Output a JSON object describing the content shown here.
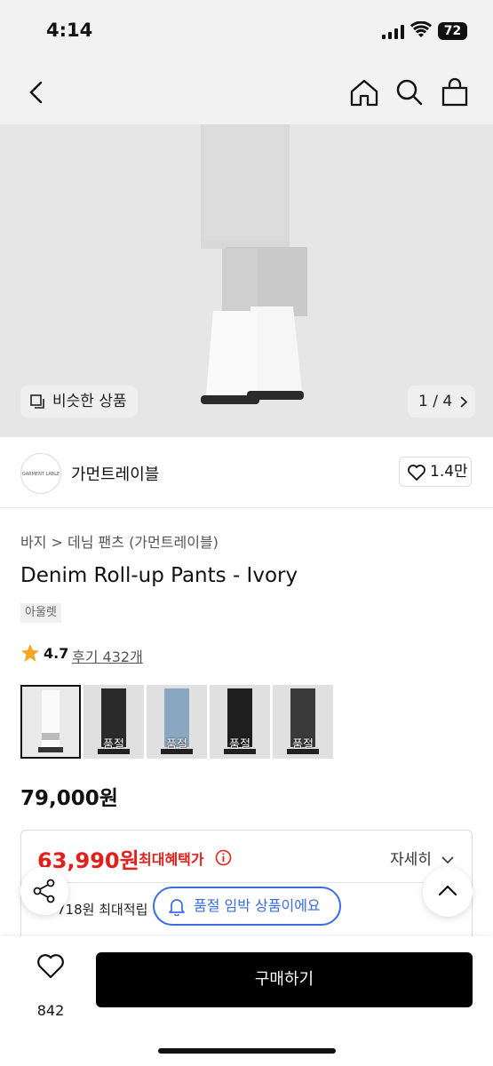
{
  "status_bar": {
    "time": "4:14",
    "battery": "72"
  },
  "nav": {
    "icons": [
      "back-icon",
      "home-icon",
      "search-icon",
      "shopping-bag-icon"
    ]
  },
  "gallery": {
    "similar_label": "비슷한 상품",
    "page_indicator": "1 / 4"
  },
  "brand": {
    "logo_text": "GARMENT LABLE",
    "name": "가먼트레이블",
    "likes": "1.4만"
  },
  "product": {
    "breadcrumb": "바지 > 데님 팬츠 (가먼트레이블)",
    "title": "Denim Roll-up Pants - Ivory",
    "tag": "아울렛",
    "rating": "4.7",
    "reviews": "후기 432개",
    "thumbnails": [
      {
        "color": "#ececec",
        "soldout": ""
      },
      {
        "color": "#2a2a2a",
        "soldout": "품절"
      },
      {
        "color": "#8aa7c2",
        "soldout": "품절"
      },
      {
        "color": "#1e1e1e",
        "soldout": "품절"
      },
      {
        "color": "#3a3a3a",
        "soldout": "품절"
      }
    ],
    "price": "79,000원"
  },
  "benefit": {
    "price": "63,990원",
    "label": "최대혜택가",
    "detail": "자세히",
    "points": "718원 최대적립"
  },
  "soldout_notice": "품절 임박 상품이에요",
  "bottom": {
    "wish_count": "842",
    "buy_label": "구매하기"
  },
  "colors": {
    "accent_red": "#e0201b",
    "accent_blue": "#3a6de0",
    "star": "#f5a623"
  }
}
